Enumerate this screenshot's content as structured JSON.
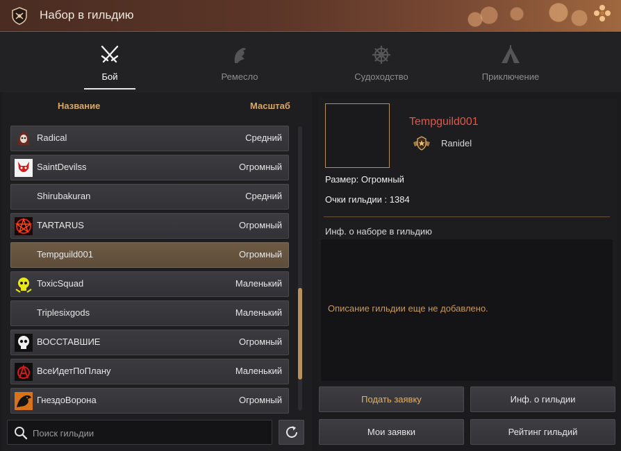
{
  "window": {
    "title": "Набор в гильдию",
    "emblem_icon": "guild-shield-icon"
  },
  "tabs": [
    {
      "label": "Бой",
      "icon": "crossed-swords-icon",
      "active": true
    },
    {
      "label": "Ремесло",
      "icon": "craft-bird-icon",
      "active": false
    },
    {
      "label": "Судоходство",
      "icon": "ship-wheel-icon",
      "active": false
    },
    {
      "label": "Приключение",
      "icon": "tent-icon",
      "active": false
    }
  ],
  "list": {
    "header_name": "Название",
    "header_scale": "Масштаб",
    "rows": [
      {
        "name": "Radical",
        "size": "Средний",
        "emblem": "hooded-reaper-icon"
      },
      {
        "name": "SaintDevilss",
        "size": "Огромный",
        "emblem": "red-devil-icon"
      },
      {
        "name": "Shirubakuran",
        "size": "Средний",
        "emblem": ""
      },
      {
        "name": "TARTARUS",
        "size": "Огромный",
        "emblem": "pentagram-icon"
      },
      {
        "name": "Tempguild001",
        "size": "Огромный",
        "emblem": "",
        "selected": true
      },
      {
        "name": "ToxicSquad",
        "size": "Маленький",
        "emblem": "toxic-skull-icon"
      },
      {
        "name": "Triplesixgods",
        "size": "Маленький",
        "emblem": ""
      },
      {
        "name": "ВОССТАВШИЕ",
        "size": "Огромный",
        "emblem": "white-skull-icon"
      },
      {
        "name": "ВсеИдетПоПлану",
        "size": "Маленький",
        "emblem": "anarchy-icon"
      },
      {
        "name": "ГнездоВорона",
        "size": "Огромный",
        "emblem": "raven-icon"
      }
    ]
  },
  "search": {
    "placeholder": "Поиск гильдии",
    "value": ""
  },
  "details": {
    "guild_name": "Tempguild001",
    "leader": "Ranidel",
    "size_line": "Размер: Огромный",
    "points_line": "Очки гильдии : 1384",
    "recruit_heading": "Инф. о наборе в гильдию",
    "description": "Описание гильдии еще не добавлено."
  },
  "buttons": {
    "apply": "Подать заявку",
    "guild_info": "Инф. о гильдии",
    "my_applications": "Мои заявки",
    "ranking": "Рейтинг гильдий"
  },
  "colors": {
    "accent": "#d9a766",
    "guild_name": "#e0584a",
    "selected_row": "#6e5a44"
  }
}
